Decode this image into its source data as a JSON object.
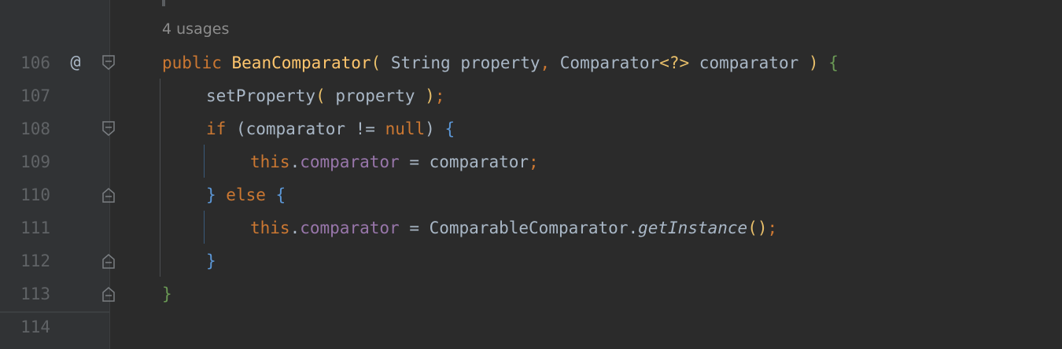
{
  "editor": {
    "usages_hint": "4 usages",
    "override_marker": "@",
    "lines": [
      {
        "num": "106",
        "annotation": "@",
        "fold": "open"
      },
      {
        "num": "107",
        "annotation": "",
        "fold": ""
      },
      {
        "num": "108",
        "annotation": "",
        "fold": "open"
      },
      {
        "num": "109",
        "annotation": "",
        "fold": ""
      },
      {
        "num": "110",
        "annotation": "",
        "fold": "close"
      },
      {
        "num": "111",
        "annotation": "",
        "fold": ""
      },
      {
        "num": "112",
        "annotation": "",
        "fold": "close"
      },
      {
        "num": "113",
        "annotation": "",
        "fold": "close"
      },
      {
        "num": "114",
        "annotation": "",
        "fold": ""
      }
    ],
    "tokens": {
      "l106": {
        "public": "public",
        "name": "BeanComparator",
        "p1": "(",
        "args": " String property",
        "comma": ",",
        "args2": " Comparator",
        "gen": "<?>",
        "args3": " comparator ",
        "p2": ")",
        "brace": "{"
      },
      "l107": {
        "call": "setProperty",
        "p1": "(",
        "arg": " property ",
        "p2": ")",
        "semi": ";"
      },
      "l108": {
        "if": "if",
        "cond1": " (comparator != ",
        "null": "null",
        "cond2": ") ",
        "brace": "{"
      },
      "l109": {
        "this": "this",
        "dot": ".",
        "field": "comparator",
        "rest": " = comparator",
        "semi": ";"
      },
      "l110": {
        "brace1": "}",
        "else": " else ",
        "brace2": "{"
      },
      "l111": {
        "this": "this",
        "dot": ".",
        "field": "comparator",
        "rest": " = ComparableComparator.",
        "method": "getInstance",
        "parens": "()",
        "semi": ";"
      },
      "l112": {
        "brace": "}"
      },
      "l113": {
        "brace": "}"
      }
    }
  },
  "colors": {
    "background": "#2b2b2b",
    "keyword": "#cc7832",
    "function_decl": "#ffc66d",
    "field": "#9876aa",
    "line_number": "#606366"
  }
}
